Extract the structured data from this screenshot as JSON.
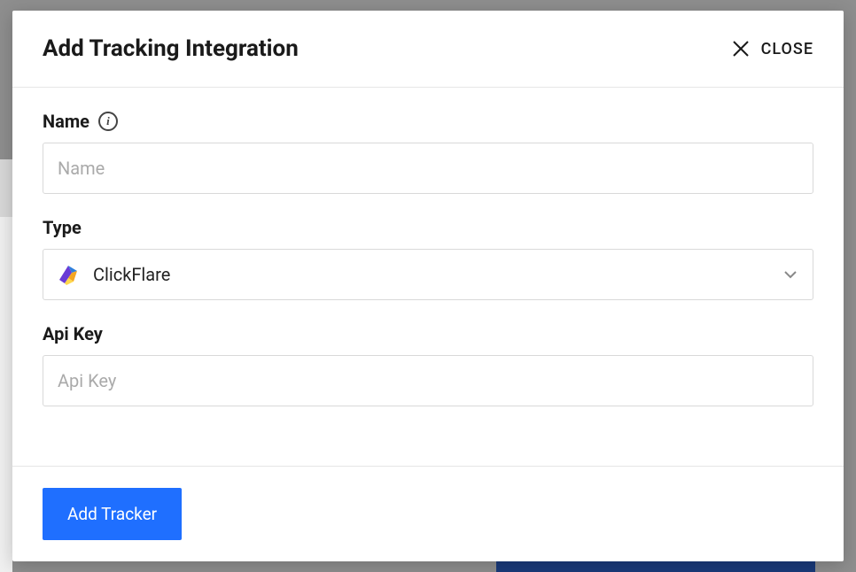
{
  "modal": {
    "title": "Add Tracking Integration",
    "close_label": "CLOSE"
  },
  "fields": {
    "name": {
      "label": "Name",
      "placeholder": "Name",
      "value": ""
    },
    "type": {
      "label": "Type",
      "selected": "ClickFlare"
    },
    "api_key": {
      "label": "Api Key",
      "placeholder": "Api Key",
      "value": ""
    }
  },
  "footer": {
    "submit_label": "Add Tracker"
  },
  "colors": {
    "primary_button": "#1f6fff"
  }
}
